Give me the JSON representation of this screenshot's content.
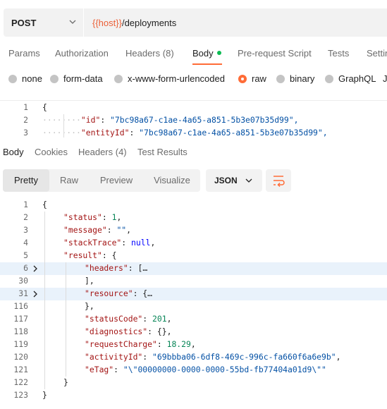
{
  "request": {
    "method": "POST",
    "url_var": "{{host}}",
    "url_path": "/deployments"
  },
  "request_tabs": [
    {
      "label": "Params"
    },
    {
      "label": "Authorization"
    },
    {
      "label": "Headers",
      "count": "(8)"
    },
    {
      "label": "Body"
    },
    {
      "label": "Pre-request Script"
    },
    {
      "label": "Tests"
    },
    {
      "label": "Settin"
    }
  ],
  "body_types": [
    {
      "label": "none"
    },
    {
      "label": "form-data"
    },
    {
      "label": "x-www-form-urlencoded"
    },
    {
      "label": "raw"
    },
    {
      "label": "binary"
    },
    {
      "label": "GraphQL"
    },
    {
      "label": "J"
    }
  ],
  "request_editor": {
    "lines": [
      {
        "n": "1",
        "text": "{"
      },
      {
        "n": "2",
        "key": "\"id\"",
        "value": "\"7bc98a67-c1ae-4a65-a851-5b3e07b35d99\","
      },
      {
        "n": "3",
        "key": "\"entityId\"",
        "value": "\"7bc98a67-c1ae-4a65-a851-5b3e07b35d99\","
      }
    ]
  },
  "response_tabs": [
    {
      "label": "Body"
    },
    {
      "label": "Cookies"
    },
    {
      "label": "Headers (4)"
    },
    {
      "label": "Test Results"
    }
  ],
  "response_toolbar": {
    "modes": [
      "Pretty",
      "Raw",
      "Preview",
      "Visualize"
    ],
    "format": "JSON"
  },
  "response_lines": [
    {
      "n": "1",
      "text": "{"
    },
    {
      "n": "2",
      "key": "\"status\"",
      "sep": ": ",
      "val": "1",
      "tail": ","
    },
    {
      "n": "3",
      "key": "\"message\"",
      "sep": ": ",
      "val": "\"\"",
      "tail": ","
    },
    {
      "n": "4",
      "key": "\"stackTrace\"",
      "sep": ": ",
      "val": "null",
      "tail": ","
    },
    {
      "n": "5",
      "key": "\"result\"",
      "sep": ": ",
      "val": "{",
      "tail": ""
    },
    {
      "n": "6",
      "key": "\"headers\"",
      "sep": ": ",
      "val": "[",
      "tail": "…"
    },
    {
      "n": "30",
      "text": "],"
    },
    {
      "n": "31",
      "key": "\"resource\"",
      "sep": ": ",
      "val": "{",
      "tail": "…"
    },
    {
      "n": "116",
      "text": "},"
    },
    {
      "n": "117",
      "key": "\"statusCode\"",
      "sep": ": ",
      "val": "201",
      "tail": ","
    },
    {
      "n": "118",
      "key": "\"diagnostics\"",
      "sep": ": ",
      "val": "{}",
      "tail": ","
    },
    {
      "n": "119",
      "key": "\"requestCharge\"",
      "sep": ": ",
      "val": "18.29",
      "tail": ","
    },
    {
      "n": "120",
      "key": "\"activityId\"",
      "sep": ": ",
      "val": "\"69bbba06-6df8-469c-996c-fa660f6a6e9b\"",
      "tail": ","
    },
    {
      "n": "121",
      "key": "\"eTag\"",
      "sep": ": ",
      "val": "\"\\\"00000000-0000-0000-55bd-fb77404a01d9\\\"\"",
      "tail": ""
    },
    {
      "n": "122",
      "text": "}"
    },
    {
      "n": "123",
      "text": "}"
    }
  ]
}
